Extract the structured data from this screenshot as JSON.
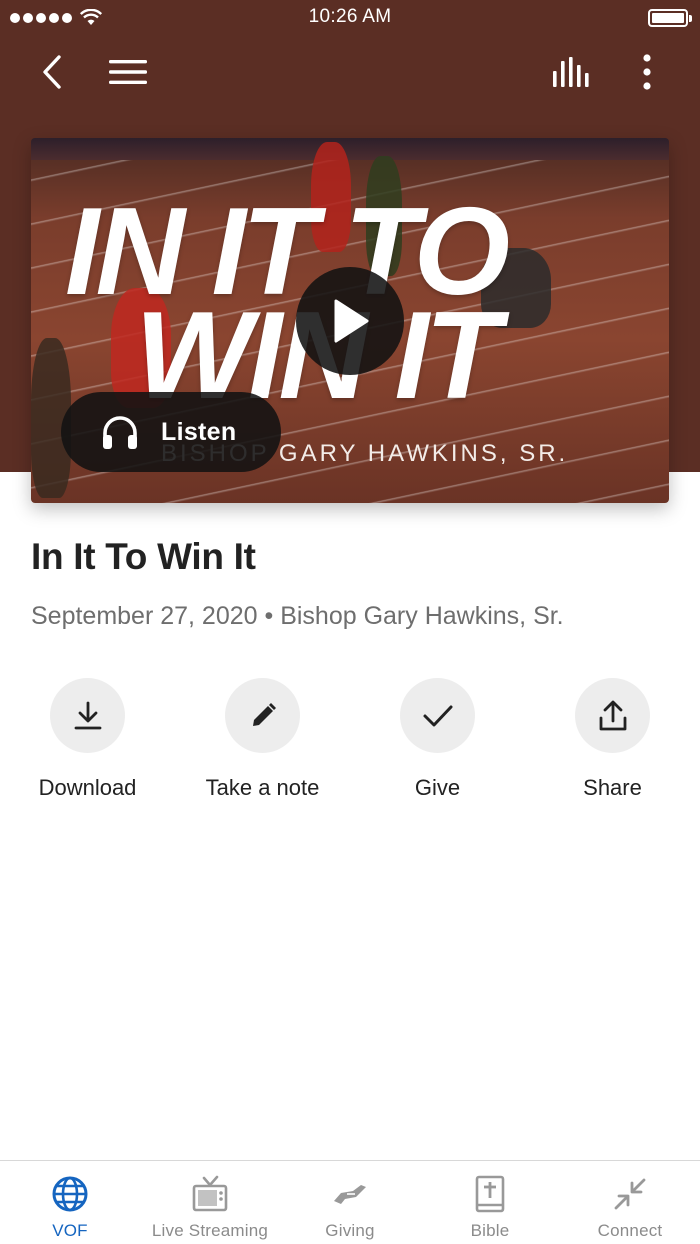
{
  "status_bar": {
    "time": "10:26 AM"
  },
  "hero": {
    "title_line1": "IN IT TO",
    "title_line2": "WIN IT",
    "subtitle": "BISHOP GARY HAWKINS, SR.",
    "listen_label": "Listen"
  },
  "sermon": {
    "title": "In It To Win It",
    "meta": "September 27, 2020 • Bishop Gary Hawkins, Sr."
  },
  "actions": [
    {
      "label": "Download",
      "icon": "download-icon"
    },
    {
      "label": "Take a note",
      "icon": "pencil-icon"
    },
    {
      "label": "Give",
      "icon": "checkmark-icon"
    },
    {
      "label": "Share",
      "icon": "share-icon"
    }
  ],
  "tabs": [
    {
      "label": "VOF",
      "icon": "globe-icon",
      "active": true
    },
    {
      "label": "Live Streaming",
      "icon": "tv-icon",
      "active": false
    },
    {
      "label": "Giving",
      "icon": "giving-hand-icon",
      "active": false
    },
    {
      "label": "Bible",
      "icon": "bible-icon",
      "active": false
    },
    {
      "label": "Connect",
      "icon": "connect-arrows-icon",
      "active": false
    }
  ],
  "colors": {
    "header_background": "#5b2e24",
    "active_tab": "#1565c0",
    "inactive_tab": "#8b8b8b",
    "action_circle": "#ededed"
  }
}
